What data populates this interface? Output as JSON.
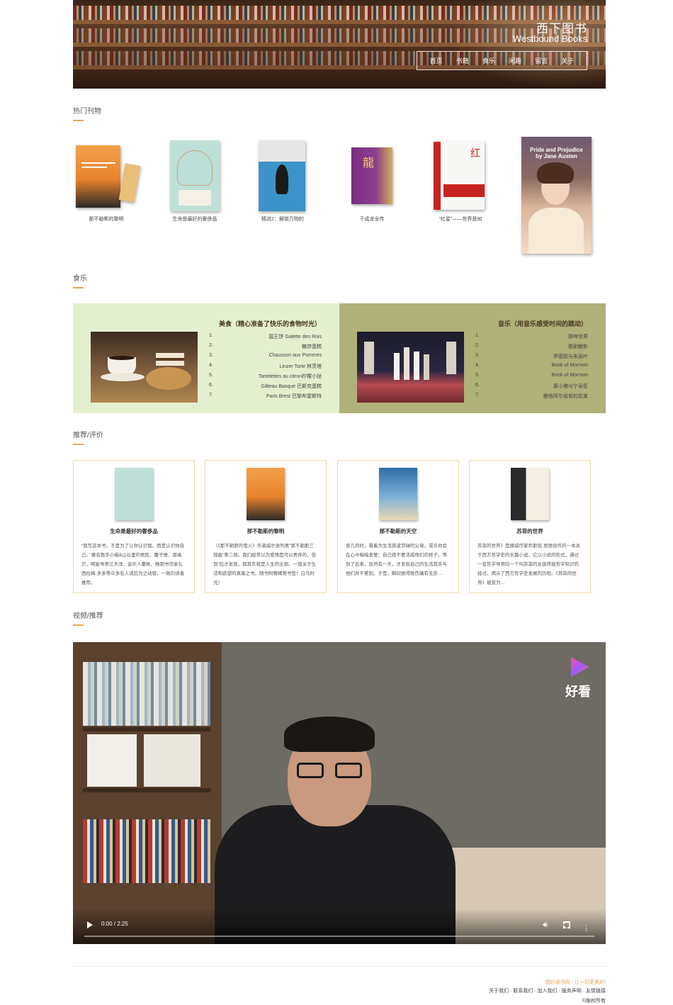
{
  "header": {
    "brand_cn": "西下图书",
    "brand_en": "Westbound Books",
    "nav": [
      "首页",
      "书籍",
      "食乐",
      "闲趣",
      "留言",
      "关于"
    ]
  },
  "sections": {
    "popular": "热门刊物",
    "food_music": "食乐",
    "reviews": "推荐/评价",
    "video": "视频/推荐"
  },
  "popular_books": [
    {
      "title": "那不勒斯的黎明"
    },
    {
      "title": "生命是最好的奢侈品"
    },
    {
      "title": "精进2：解锁万物的"
    },
    {
      "title": "于成龙全传"
    },
    {
      "title": "“红星”——世界是如"
    },
    {
      "title": "",
      "cover_text": "Pride and Prejudice by Jane Austen"
    }
  ],
  "food": {
    "title": "美食（精心准备了快乐的食物时光）",
    "items": [
      "国王饼 Galette des Rois",
      "糖饼蛋糕",
      "Chausson aux Pommes",
      "Linzer Torte 林茨塔",
      "Tartelettes au citron柠檬小挞",
      "Gâteau Basque 巴斯克蛋糕",
      "Paris Brest 巴黎布雷斯特"
    ]
  },
  "music": {
    "title": "音乐（用音乐感受时间的跳动）",
    "items": [
      "那啼世界",
      "歌剧魅影",
      "罗密欧与朱丽叶",
      "Book of Mormon",
      "Book of Mormon",
      "慕小佛与宁采臣",
      "酿格阿尔省依的花束"
    ]
  },
  "reviews": [
    {
      "title": "生命是最好的奢侈品",
      "text": "“我写这本书，不是为了让你认识我，而是认识你自己。” 著名歌手小娟&山谷里的居民、蕾子惟、邵禹贝、明星导师兰天洋、音乐人董彬、畅销书作家扎西拉姆·多多等众多名人读后为之动容，一致向读者推荐。"
    },
    {
      "title": "那不勒斯的黎明",
      "text": "（《那不勒斯的萤火》作者威尔逊列奥“那不勒斯三部曲”第二部。我们经常以为爱情是可以舍弃的，但到“后才发现，那其实就是人生的全部。一部关于生活和欲望的真基之书。随书附赠精美书签！白马时光）"
    },
    {
      "title": "那不勒斯的天空",
      "text": "曾几何时，看着为生活奔波劳碌的父母，或许你会在心中暗暗发誓：自己绝不要活成他们的样子。等到了后来，忽然有一天，才发现自己的生活其实与他们并不差别。于是，瞬间觉得既伤痛有无奈…"
    },
    {
      "title": "苏菲的世界",
      "text": "苏菲的世界》是挪威作家乔斯坦·贾德创作的一本关于西方哲学史的长篇小说，它以小说的形式，通过一名哲学导师向一个叫苏菲的女孩传授哲学知识的经过，揭示了西方哲学史发展的历程。《苏菲的世界》被誉为…"
    }
  ],
  "video": {
    "logo_text": "好看",
    "time": "0:00 / 2:25",
    "progress": 0
  },
  "footer": {
    "slogan": "我的读书网 - 让一切更美好!",
    "links": "关于我们 · 联系我们 · 加入我们 · 服务声明 · 友情链接",
    "copyright": "©版权所有"
  },
  "colors": {
    "accent": "#e0a95a",
    "food_bg": "#e4efd0",
    "music_bg": "#b0b079",
    "card_border": "#f0d9a8"
  }
}
